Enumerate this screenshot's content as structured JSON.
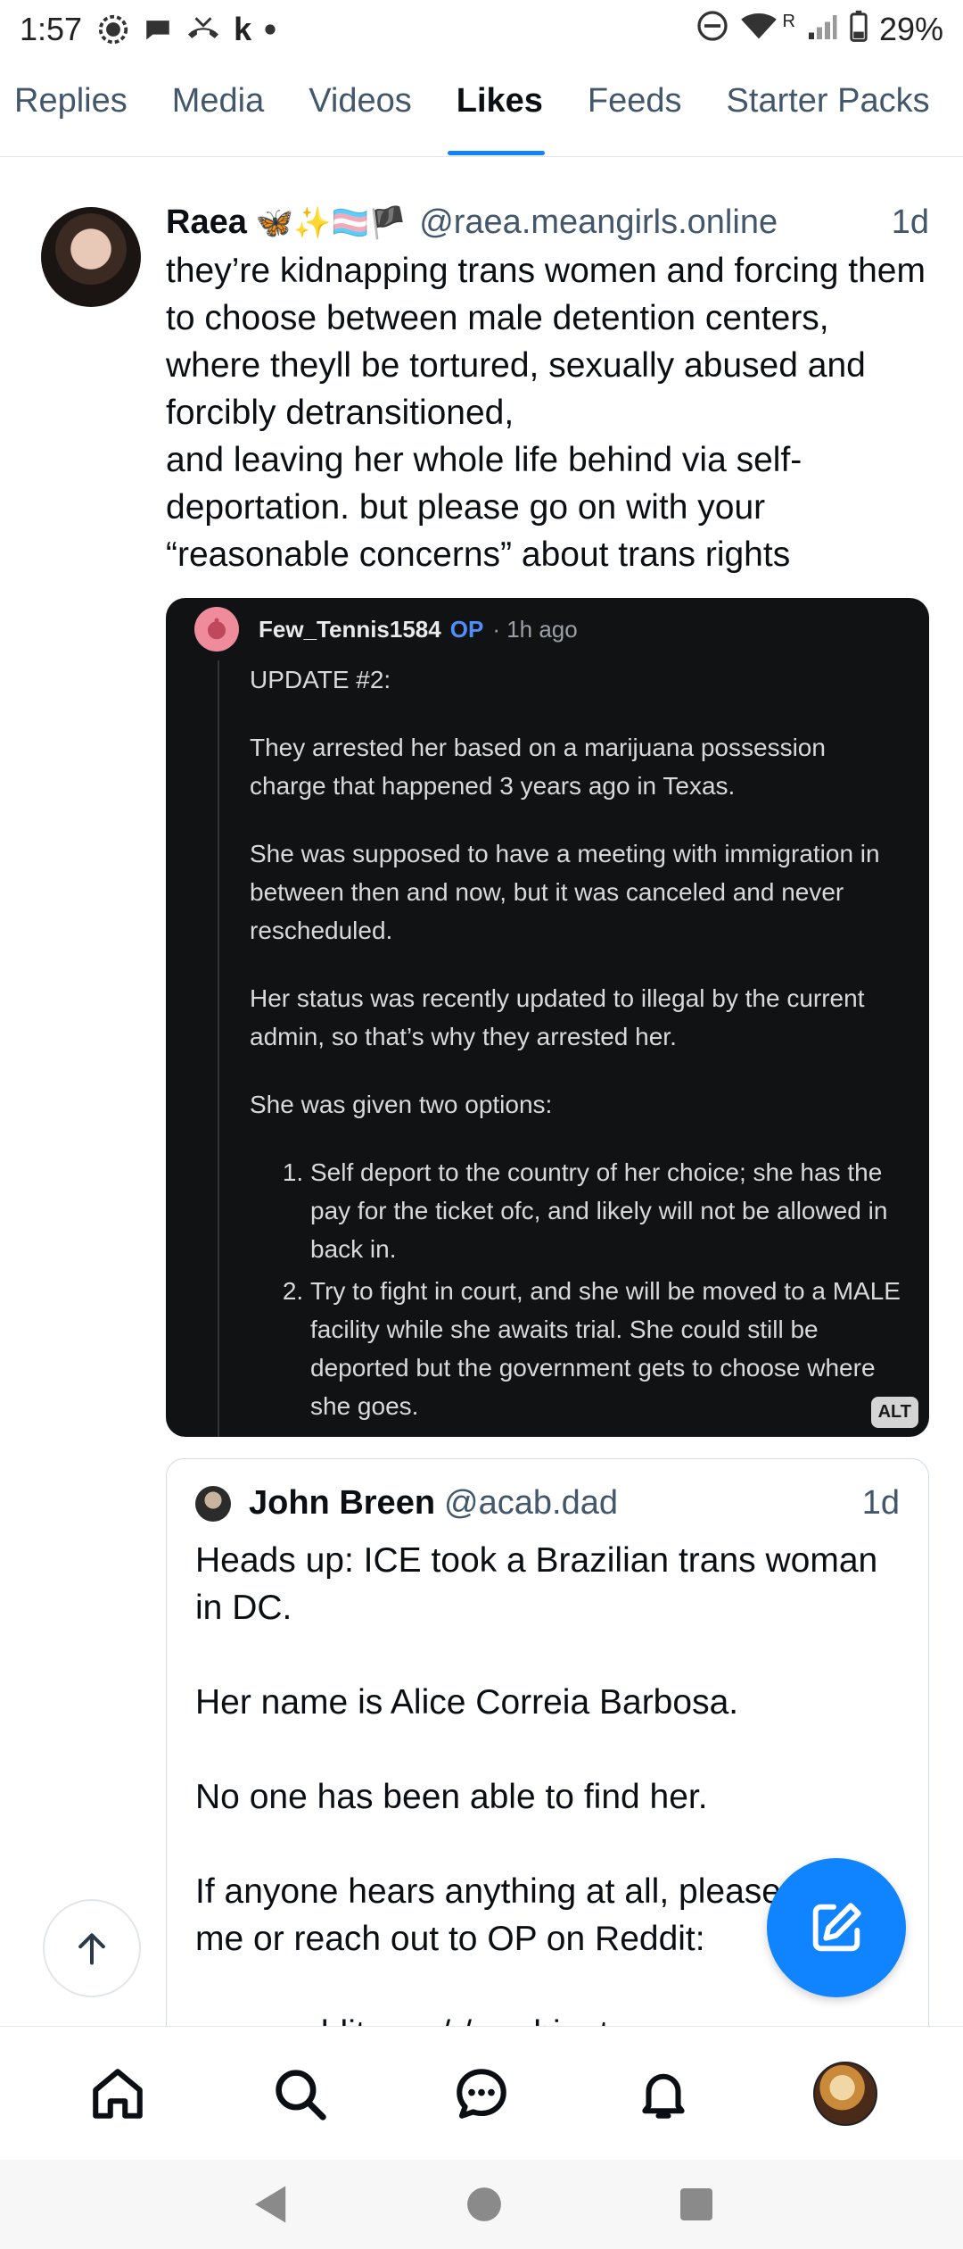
{
  "status_bar": {
    "time": "1:57",
    "extra_letter": "k",
    "battery": "29%",
    "network_label": "R"
  },
  "tabs": [
    {
      "label": "Replies",
      "active": false
    },
    {
      "label": "Media",
      "active": false
    },
    {
      "label": "Videos",
      "active": false
    },
    {
      "label": "Likes",
      "active": true
    },
    {
      "label": "Feeds",
      "active": false
    },
    {
      "label": "Starter Packs",
      "active": false
    }
  ],
  "post": {
    "display_name": "Raea",
    "name_emojis": "🦋✨🏳️‍⚧️🏴",
    "handle": "@raea.meangirls.online",
    "time_ago": "1d",
    "text": "they’re kidnapping trans women and forcing them to choose between male detention centers, where theyll be tortured, sexually abused and forcibly detransitioned,\nand leaving her whole life behind via self-deportation. but please go on with your “reasonable concerns” about trans rights",
    "image": {
      "username": "Few_Tennis1584",
      "op_badge": "OP",
      "time_ago": "· 1h ago",
      "paragraphs": [
        "UPDATE #2:",
        "They arrested her based on a marijuana possession charge that happened 3 years ago in Texas.",
        "She was supposed to have a meeting with immigration in between then and now, but it was canceled and never rescheduled.",
        "Her status was recently updated to illegal by the current admin, so that’s why they arrested her.",
        "She was given two options:"
      ],
      "list": [
        "Self deport to the country of her choice; she has the pay for the ticket ofc, and likely will not be allowed in back in.",
        "Try to fight in court, and she will be moved to a MALE facility while she awaits trial. She could still be deported but the government gets to choose where she goes."
      ],
      "alt_badge": "ALT"
    },
    "quote": {
      "display_name": "John Breen",
      "handle": "@acab.dad",
      "time_ago": "1d",
      "text": "Heads up: ICE took a Brazilian trans woman in DC.\n\nHer name is Alice Correia Barbosa.\n\nNo one has been able to find her.\n\nIf anyone hears anything at all, please DM me or reach out to OP on Reddit:\n\nwww.reddit.com/r/washington..."
    }
  },
  "icons": {
    "scroll_top": "arrow-up-icon",
    "compose": "pencil-square-icon",
    "nav": [
      "home-icon",
      "search-icon",
      "chat-icon",
      "bell-icon",
      "profile-avatar"
    ],
    "system": [
      "back-icon",
      "home-circle-icon",
      "recents-icon"
    ]
  },
  "colors": {
    "accent": "#1083fe",
    "muted_text": "#42576c",
    "reddit_op": "#4f8ef7"
  }
}
